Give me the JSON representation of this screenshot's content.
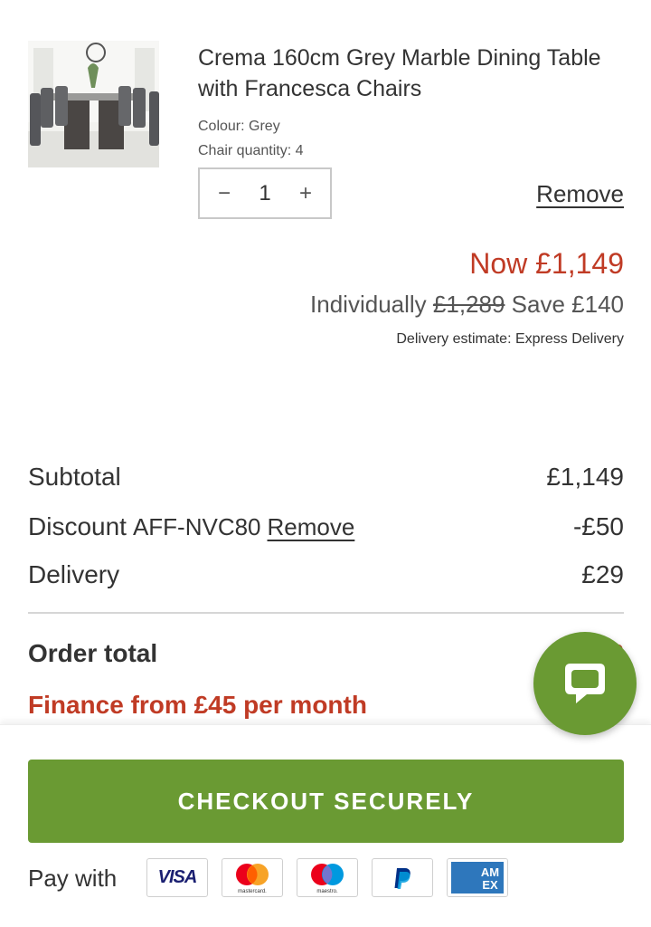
{
  "product": {
    "image_alt": "Grey marble dining table with chairs",
    "title": "Crema 160cm Grey Marble Dining Table with Francesca Chairs",
    "colour_label": "Colour:",
    "colour_value": "Grey",
    "chair_qty_label": "Chair quantity:",
    "chair_qty_value": "4",
    "quantity": "1",
    "qty_minus": "−",
    "qty_plus": "+",
    "remove_label": "Remove"
  },
  "pricing": {
    "now": "Now £1,149",
    "individually_label": "Individually",
    "was": "£1,289",
    "save": "Save £140",
    "delivery_estimate": "Delivery estimate: Express Delivery"
  },
  "summary": {
    "subtotal_label": "Subtotal",
    "subtotal_value": "£1,149",
    "discount_label": "Discount",
    "discount_code": "AFF-NVC80",
    "discount_remove": "Remove",
    "discount_value": "-£50",
    "delivery_label": "Delivery",
    "delivery_value": "£29",
    "order_total_label": "Order total",
    "order_total_value": "£",
    "finance_text": "Finance from £45 per month"
  },
  "footer": {
    "checkout_label": "CHECKOUT SECURELY",
    "pay_with_label": "Pay with",
    "payment_methods": {
      "visa": "VISA",
      "mastercard": "mastercard.",
      "maestro": "maestro",
      "amex": "AM EX"
    }
  },
  "colors": {
    "accent_green": "#6a9a33",
    "price_red": "#c03b25"
  },
  "icons": {
    "chat": "chat-icon",
    "minus": "minus-icon",
    "plus": "plus-icon"
  }
}
